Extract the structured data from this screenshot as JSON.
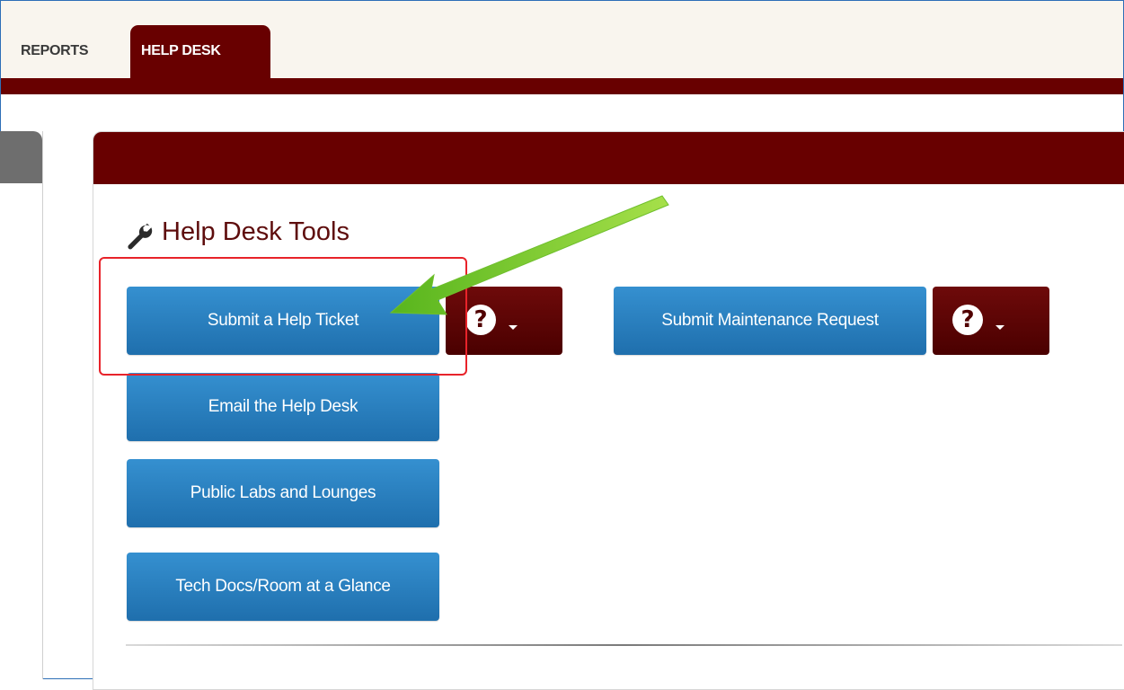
{
  "nav": {
    "tabs": [
      {
        "label": "REPORTS",
        "active": false
      },
      {
        "label": "HELP DESK",
        "active": true
      }
    ]
  },
  "panel": {
    "title": "Help Desk Tools",
    "title_icon": "wrench-icon"
  },
  "buttons": {
    "submit_ticket": "Submit a Help Ticket",
    "email_helpdesk": "Email the Help Desk",
    "public_labs": "Public Labs and Lounges",
    "tech_docs": "Tech Docs/Room at a Glance",
    "maintenance": "Submit Maintenance Request"
  },
  "help_dropdowns": [
    {
      "icon": "question-circle-icon",
      "glyph": "?"
    },
    {
      "icon": "question-circle-icon",
      "glyph": "?"
    }
  ],
  "colors": {
    "brand_maroon": "#680000",
    "button_blue": "#2a82c4",
    "annotation_red": "#e8232a",
    "annotation_arrow_green": "#7ccf2a"
  }
}
